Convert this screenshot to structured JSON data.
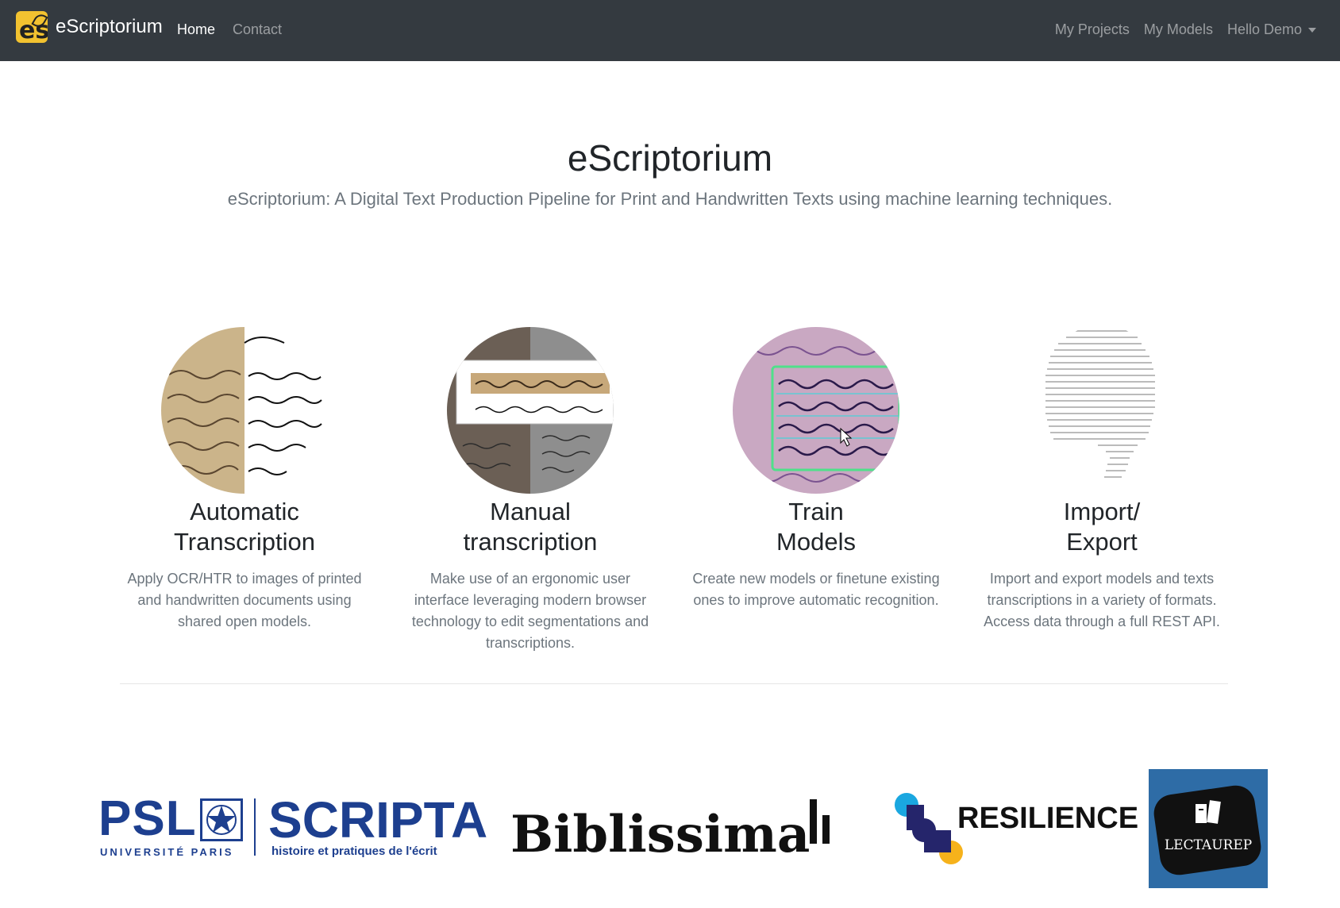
{
  "navbar": {
    "brand": "eScriptorium",
    "logo_text": "es",
    "left_links": [
      "Home",
      "Contact"
    ],
    "right_links": [
      "My Projects",
      "My Models"
    ],
    "user_menu": "Hello Demo"
  },
  "hero": {
    "title": "eScriptorium",
    "subtitle": "eScriptorium: A Digital Text Production Pipeline for Print and Handwritten Texts using machine learning techniques."
  },
  "features": [
    {
      "title_line1": "Automatic",
      "title_line2": "Transcription",
      "desc": "Apply OCR/HTR to images of printed and handwritten documents using shared open models.",
      "icon": "manuscript-transcription-icon"
    },
    {
      "title_line1": "Manual",
      "title_line2": "transcription",
      "desc": "Make use of an ergonomic user interface leveraging modern browser technology to edit segmentations and transcriptions.",
      "icon": "transcription-editor-icon"
    },
    {
      "title_line1": "Train",
      "title_line2": "Models",
      "desc": "Create new models or finetune existing ones to improve automatic recognition.",
      "icon": "segmentation-training-icon"
    },
    {
      "title_line1": "Import/",
      "title_line2": "Export",
      "desc": "Import and export models and texts transcriptions in a variety of formats. Access data through a full REST API.",
      "icon": "text-export-icon"
    }
  ],
  "partners": {
    "psl": {
      "name": "PSL",
      "sub": "UNIVERSITÉ PARIS"
    },
    "scripta": {
      "name": "SCRIPTA",
      "sub": "histoire et pratiques de l'écrit"
    },
    "biblissima": {
      "name": "Biblissima"
    },
    "resilience": {
      "name": "RESILIENCE"
    },
    "lectaurep": {
      "name": "LECTAUREP"
    }
  },
  "colors": {
    "navbar": "#343a40",
    "psl_blue": "#1d3f8f",
    "lectaurep_bg": "#2e6ca6",
    "resilience_cyan": "#1aa7e0",
    "resilience_navy": "#25256b",
    "resilience_yellow": "#f6b21b"
  }
}
